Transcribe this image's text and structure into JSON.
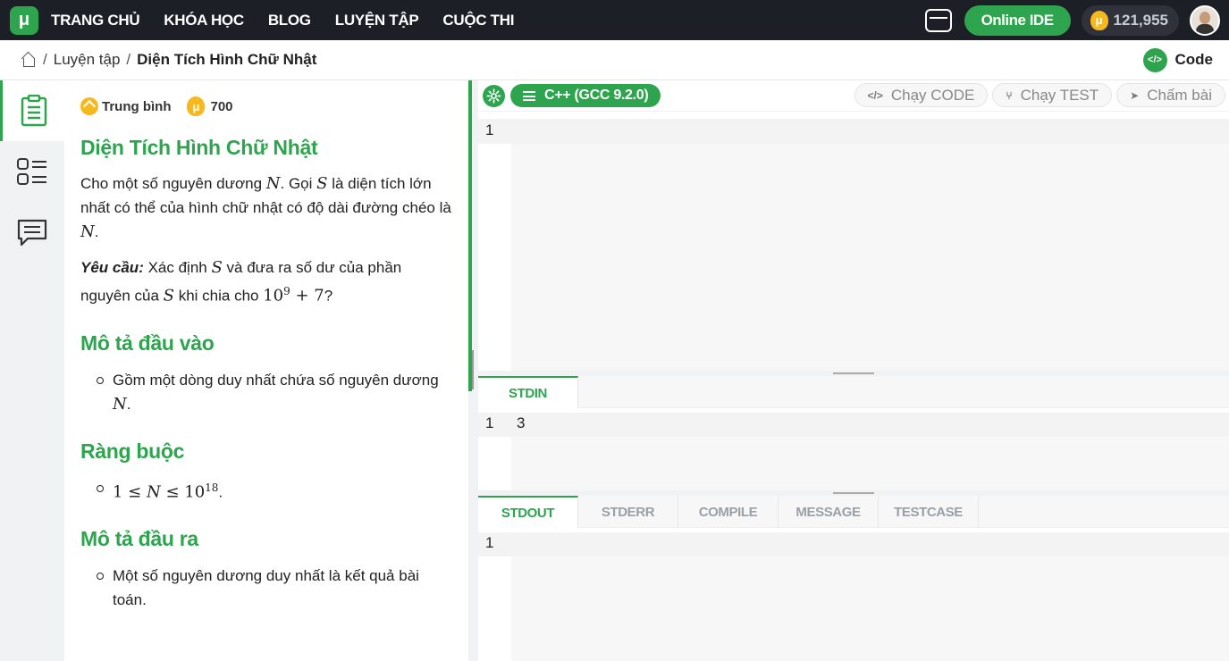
{
  "nav": {
    "logo": "μ",
    "items": [
      "TRANG CHỦ",
      "KHÓA HỌC",
      "BLOG",
      "LUYỆN TẬP",
      "CUỘC THI"
    ],
    "ide_label": "Online IDE",
    "coin_symbol": "μ",
    "coins": "121,955"
  },
  "breadcrumb": {
    "items": [
      "Luyện tập",
      "Diện Tích Hình Chữ Nhật"
    ],
    "separator": "/",
    "code_label": "Code",
    "code_icon_text": "</>"
  },
  "problem": {
    "difficulty": "Trung bình",
    "points": "700",
    "points_symbol": "μ",
    "title": "Diện Tích Hình Chữ Nhật",
    "statement": {
      "t1": "Cho một số nguyên dương ",
      "N": "N",
      "t2": ". Gọi ",
      "S": "S",
      "t3": " là diện tích lớn nhất có thể của hình chữ nhật có độ dài đường chéo là ",
      "t4": "."
    },
    "requirement": {
      "label": "Yêu cầu:",
      "t1": " Xác định ",
      "t2": " và đưa ra số dư của phần nguyên của ",
      "t3": " khi chia cho ",
      "mod": "10",
      "mod_exp": "9",
      "mod_plus": " + 7",
      "t4": "?"
    },
    "input_heading": "Mô tả đầu vào",
    "input_text": "Gồm một dòng duy nhất chứa số nguyên dương ",
    "constraint_heading": "Ràng buộc",
    "constraint": {
      "lhs": "1 ≤ ",
      "mid": " ≤ 10",
      "exp": "18",
      "end": "."
    },
    "output_heading": "Mô tả đầu ra",
    "output_text": "Một số nguyên dương duy nhất là kết quả bài toán."
  },
  "editor": {
    "language": "C++ (GCC 9.2.0)",
    "run_code": "Chạy CODE",
    "run_code_icon": "</>",
    "run_test": "Chạy TEST",
    "run_test_icon": "⑂",
    "submit": "Chấm bài",
    "submit_icon": "➤",
    "code_line": "1",
    "stdin_tab": "STDIN",
    "stdin_line": "1",
    "stdin_value": "3",
    "output_tabs": [
      "STDOUT",
      "STDERR",
      "COMPILE",
      "MESSAGE",
      "TESTCASE"
    ],
    "stdout_line": "1"
  },
  "colors": {
    "accent": "#2ea44f",
    "topbar": "#1d1f26",
    "coin": "#f5b81e"
  }
}
